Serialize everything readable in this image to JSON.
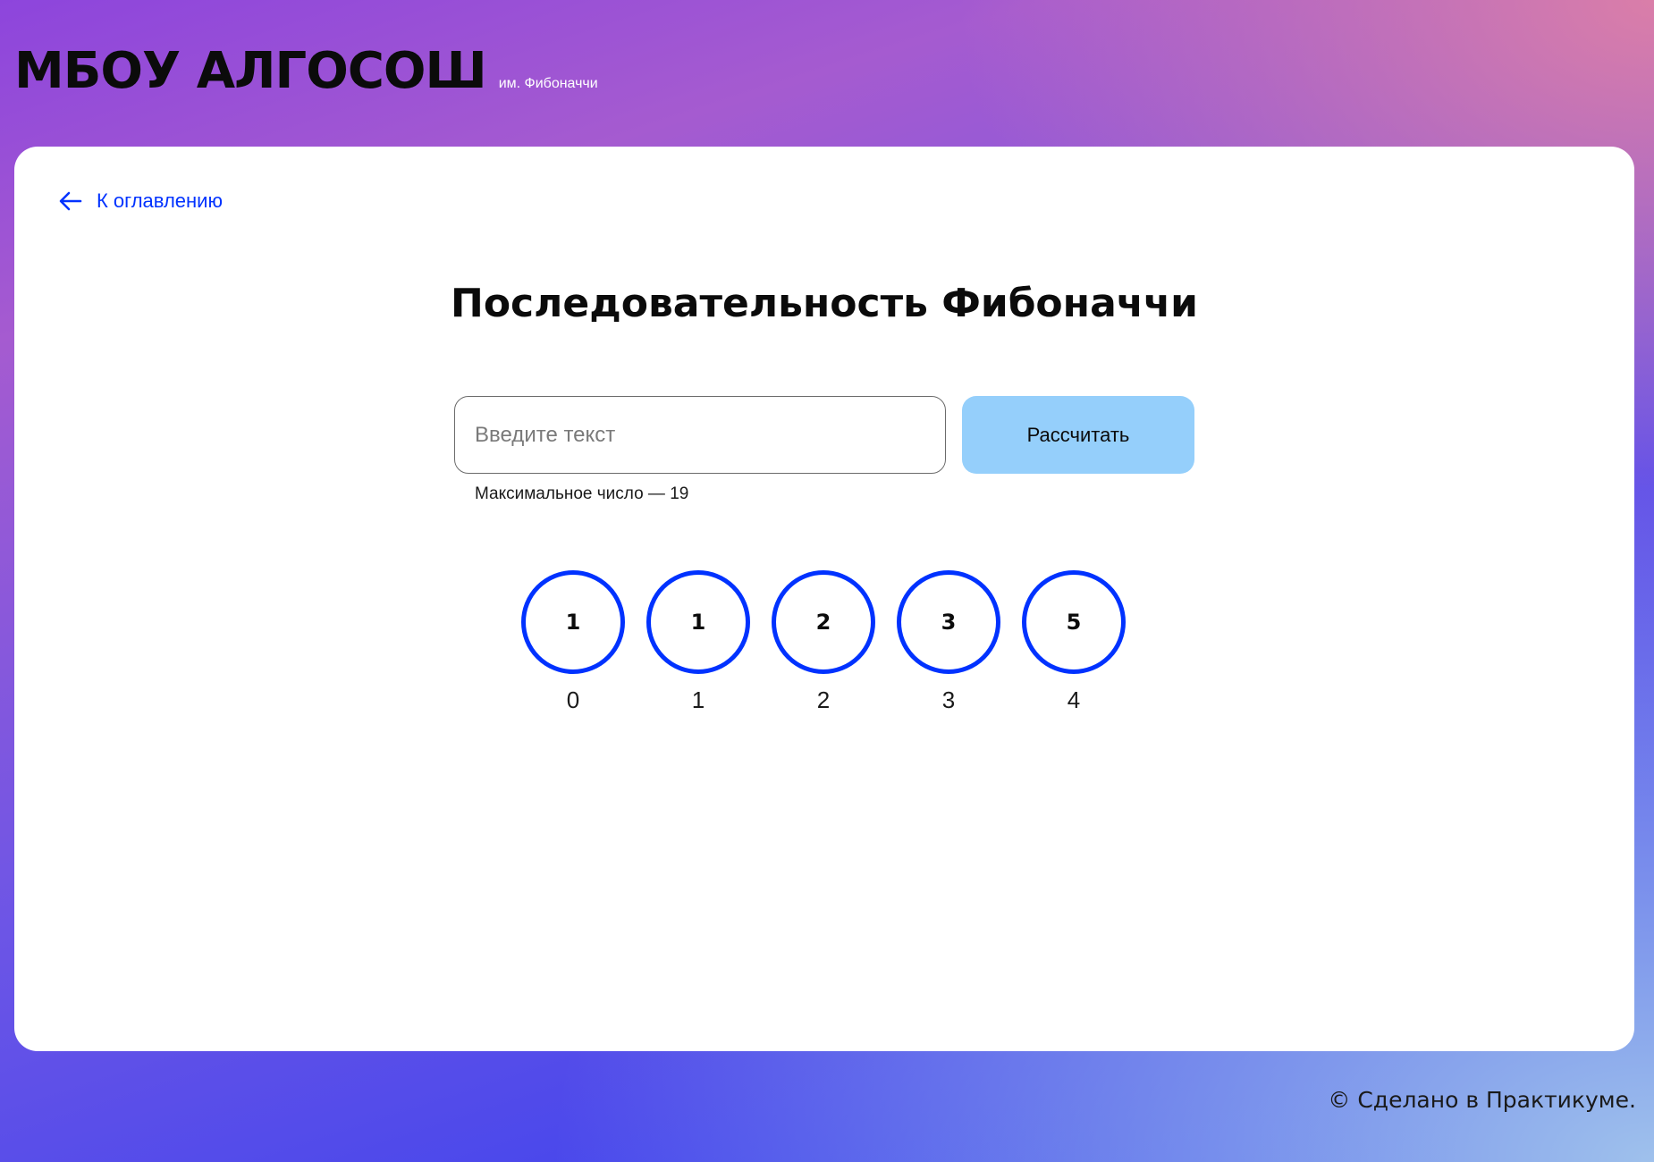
{
  "header": {
    "logo": "МБОУ АЛГОСОШ",
    "logo_subtitle": "им. Фибоначчи"
  },
  "nav": {
    "back_label": "К оглавлению",
    "back_icon": "arrow-left-icon"
  },
  "page": {
    "title": "Последовательность Фибоначчи"
  },
  "form": {
    "input_value": "",
    "input_placeholder": "Введите текст",
    "hint": "Максимальное число — 19",
    "button_label": "Рассчитать"
  },
  "result": {
    "items": [
      {
        "value": "1",
        "index": "0"
      },
      {
        "value": "1",
        "index": "1"
      },
      {
        "value": "2",
        "index": "2"
      },
      {
        "value": "3",
        "index": "3"
      },
      {
        "value": "5",
        "index": "4"
      }
    ]
  },
  "footer": {
    "text": "© Сделано в Практикуме."
  },
  "colors": {
    "accent": "#0032ff",
    "button_bg": "#95cffb",
    "card_bg": "#ffffff"
  }
}
